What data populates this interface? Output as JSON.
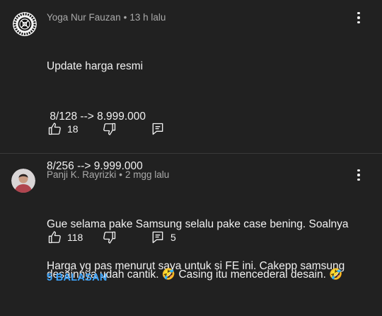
{
  "comments": [
    {
      "author": "Yoga Nur Fauzan",
      "time": "13 h lalu",
      "lines": [
        "Update harga resmi",
        " 8/128 --> 8.999.000",
        "8/256 --> 9.999.000",
        "",
        "Harga yg pas menurut saya untuk si FE ini. Cakepp samsung"
      ],
      "likes": "18"
    },
    {
      "author": "Panji K. Rayrizki",
      "time": "2 mgg lalu",
      "line1": "Gue selama pake Samsung selalu pake case bening. Soalnya",
      "line2": "desainnya udah cantik. 🤣 Casing itu mencederai desain. 🤣",
      "likes": "118",
      "reply_count": "5"
    }
  ],
  "replies_label": "5 BALASAN",
  "separator": "•",
  "colors": {
    "background": "#212121",
    "link": "#3ea6ff",
    "meta": "#aaaaaa"
  },
  "icons": [
    "like-icon",
    "dislike-icon",
    "reply-icon",
    "more-options-icon"
  ]
}
